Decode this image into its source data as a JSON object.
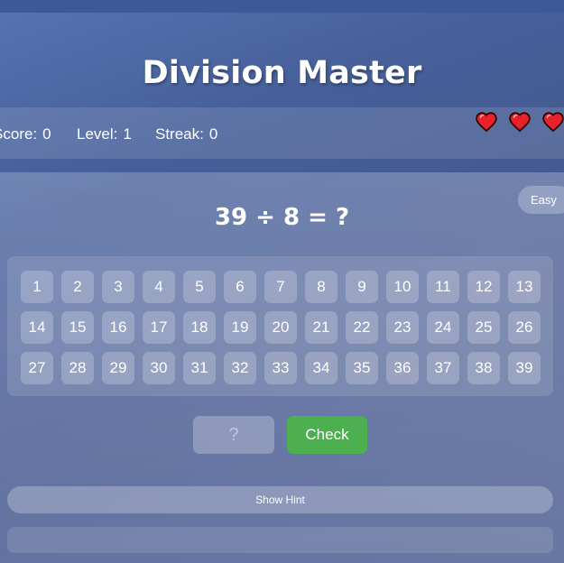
{
  "game": {
    "title": "Division Master"
  },
  "stats": {
    "score_label": "Score:",
    "score_value": "0",
    "level_label": "Level:",
    "level_value": "1",
    "streak_label": "Streak:",
    "streak_value": "0",
    "lives": 3,
    "heart_color": "#e8212b"
  },
  "difficulty": "Easy",
  "question": "39 ÷ 8 = ?",
  "number_grid": [
    "1",
    "2",
    "3",
    "4",
    "5",
    "6",
    "7",
    "8",
    "9",
    "10",
    "11",
    "12",
    "13",
    "14",
    "15",
    "16",
    "17",
    "18",
    "19",
    "20",
    "21",
    "22",
    "23",
    "24",
    "25",
    "26",
    "27",
    "28",
    "29",
    "30",
    "31",
    "32",
    "33",
    "34",
    "35",
    "36",
    "37",
    "38",
    "39"
  ],
  "answer": {
    "placeholder": "?",
    "value": ""
  },
  "buttons": {
    "check": "Check",
    "hint": "Show Hint"
  },
  "colors": {
    "check_button": "#4caf50"
  }
}
